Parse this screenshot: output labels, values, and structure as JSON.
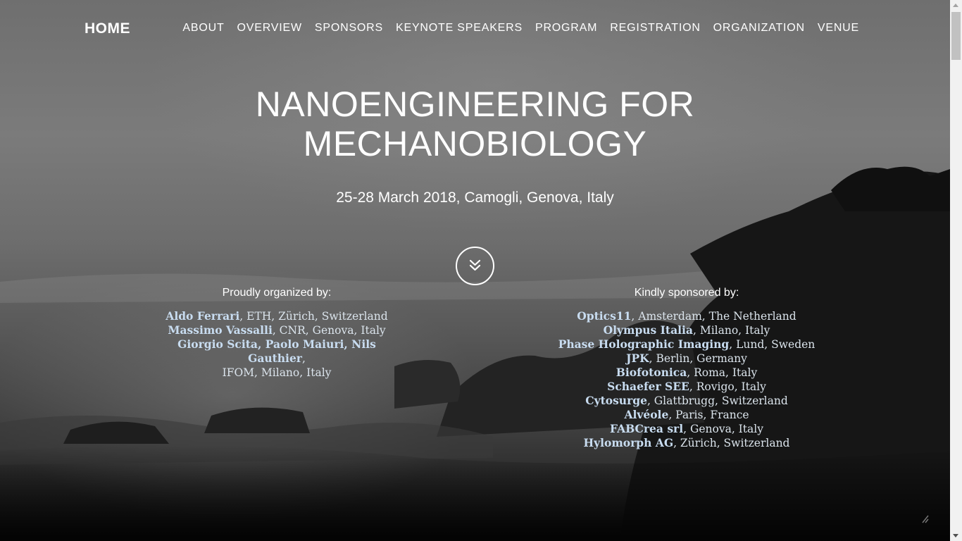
{
  "nav": {
    "brand": "HOME",
    "items": [
      "ABOUT",
      "OVERVIEW",
      "SPONSORS",
      "KEYNOTE SPEAKERS",
      "PROGRAM",
      "REGISTRATION",
      "ORGANIZATION",
      "VENUE"
    ]
  },
  "hero": {
    "title_line1": "NANOENGINEERING FOR",
    "title_line2": "MECHANOBIOLOGY",
    "subtitle": "25-28 March 2018, Camogli, Genova, Italy",
    "scroll_icon": "double-chevron-down-icon"
  },
  "organizers": {
    "heading": "Proudly organized by:",
    "lines": [
      {
        "names": "Aldo Ferrari",
        "rest": ", ETH, Zürich, Switzerland"
      },
      {
        "names": "Massimo Vassalli",
        "rest": ", CNR, Genova, Italy"
      },
      {
        "names": "Giorgio Scita, Paolo Maiuri, Nils Gauthier",
        "rest": ","
      },
      {
        "names": "",
        "rest": "IFOM, Milano, Italy"
      }
    ]
  },
  "sponsors": {
    "heading": "Kindly sponsored by:",
    "lines": [
      {
        "names": "Optics11",
        "rest": ", Amsterdam, The Netherland"
      },
      {
        "names": "Olympus Italia",
        "rest": ", Milano, Italy"
      },
      {
        "names": "Phase Holographic Imaging",
        "rest": ", Lund, Sweden"
      },
      {
        "names": "JPK",
        "rest": ", Berlin, Germany"
      },
      {
        "names": "Biofotonica",
        "rest": ", Roma, Italy"
      },
      {
        "names": "Schaefer SEE",
        "rest": ", Rovigo, Italy"
      },
      {
        "names": "Cytosurge",
        "rest": ", Glattbrugg, Switzerland"
      },
      {
        "names": "Alvéole",
        "rest": ", Paris, France"
      },
      {
        "names": "FABCrea srl",
        "rest": ", Genova, Italy"
      },
      {
        "names": "Hylomorph AG",
        "rest": ", Zürich, Switzerland"
      }
    ]
  },
  "colors": {
    "link_highlight": "#c8dcf0",
    "text": "#ffffff"
  }
}
